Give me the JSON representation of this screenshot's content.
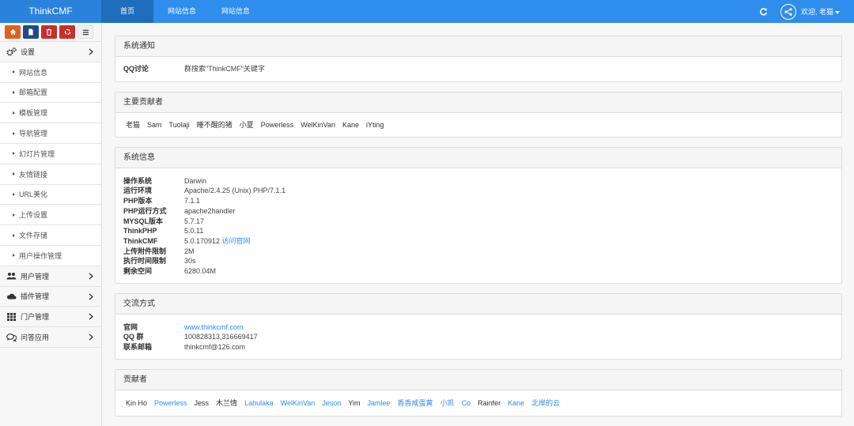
{
  "brand": "ThinkCMF",
  "topnav": [
    "首页",
    "网站信息",
    "网站信息"
  ],
  "user": {
    "welcome": "欢迎, 老猫"
  },
  "sidebar": {
    "settings": "设置",
    "settings_items": [
      "网站信息",
      "邮箱配置",
      "模板管理",
      "导航管理",
      "幻灯片管理",
      "友情链接",
      "URL美化",
      "上传设置",
      "文件存储",
      "用户操作管理"
    ],
    "groups": [
      "用户管理",
      "插件管理",
      "门户管理",
      "问答应用"
    ]
  },
  "notice": {
    "title": "系统通知",
    "key": "QQ讨论",
    "value": "群搜索\"ThinkCMF\"关键字"
  },
  "major": {
    "title": "主要贡献者",
    "names": [
      "老猫",
      "Sam",
      "Tuolaji",
      "睡不醒的猪",
      "小夏",
      "Powerless",
      "WelKinVan",
      "Kane",
      "iYting"
    ]
  },
  "sysinfo": {
    "title": "系统信息",
    "rows": [
      {
        "k": "操作系统",
        "v": "Darwin"
      },
      {
        "k": "运行环境",
        "v": "Apache/2.4.25 (Unix) PHP/7.1.1"
      },
      {
        "k": "PHP版本",
        "v": "7.1.1"
      },
      {
        "k": "PHP运行方式",
        "v": "apache2handler"
      },
      {
        "k": "MYSQL版本",
        "v": "5.7.17"
      },
      {
        "k": "ThinkPHP",
        "v": "5.0.11"
      },
      {
        "k": "ThinkCMF",
        "v": "5.0.170912 ",
        "link": "访问官网"
      },
      {
        "k": "上传附件限制",
        "v": "2M"
      },
      {
        "k": "执行时间限制",
        "v": "30s"
      },
      {
        "k": "剩余空间",
        "v": "6280.04M"
      }
    ]
  },
  "contact": {
    "title": "交流方式",
    "rows": [
      {
        "k": "官网",
        "link": "www.thinkcmf.com"
      },
      {
        "k": "QQ 群",
        "v": "100828313,316669417"
      },
      {
        "k": "联系邮箱",
        "v": "thinkcmf@126.com"
      }
    ]
  },
  "contributors": {
    "title": "贡献者",
    "names": [
      {
        "n": "Kin Ho",
        "link": false
      },
      {
        "n": "Powerless",
        "link": true
      },
      {
        "n": "Jess",
        "link": false
      },
      {
        "n": "木兰情",
        "link": false
      },
      {
        "n": "Labulaka",
        "link": true
      },
      {
        "n": "WelKinVan",
        "link": true
      },
      {
        "n": "Jeson",
        "link": true
      },
      {
        "n": "Yim",
        "link": false
      },
      {
        "n": "Jamlee",
        "link": true
      },
      {
        "n": "香香咸蛋黄",
        "link": true
      },
      {
        "n": "小凯",
        "link": true
      },
      {
        "n": "Co",
        "link": true
      },
      {
        "n": "Rainfer",
        "link": false
      },
      {
        "n": "Kane",
        "link": true
      },
      {
        "n": "北岸的云",
        "link": true
      }
    ]
  },
  "colors": {
    "topbar": "#2e8ded",
    "link": "#2e8ded",
    "orange": "#e0611d",
    "navy": "#1f4c85",
    "red": "#c9302c"
  }
}
